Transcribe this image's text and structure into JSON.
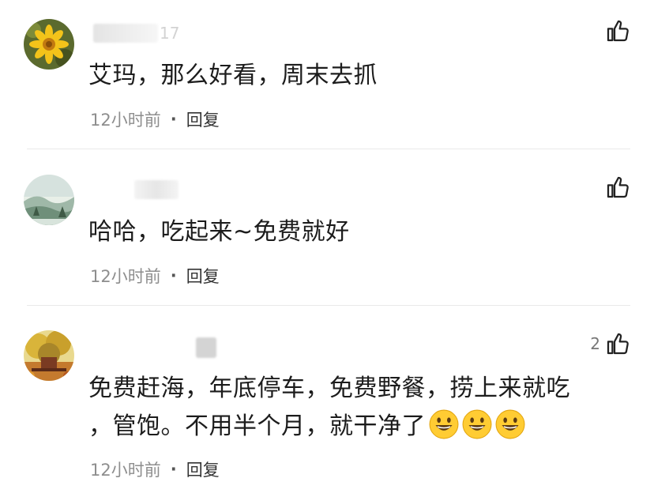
{
  "comments": [
    {
      "username_tail": "17",
      "text": "艾玛，那么好看，周末去抓",
      "time": "12小时前",
      "dot": "·",
      "reply": "回复",
      "likes": ""
    },
    {
      "username_tail": "",
      "text": "哈哈，吃起来~免费就好",
      "time": "12小时前",
      "dot": "·",
      "reply": "回复",
      "likes": ""
    },
    {
      "username_tail": "",
      "text_line1": "免费赶海，年底停车，免费野餐，捞上来就吃",
      "text_line2": "，管饱。不用半个月，就干净了",
      "time": "12小时前",
      "dot": "·",
      "reply": "回复",
      "likes": "2"
    }
  ],
  "icons": {
    "like": "thumbs-up-icon",
    "emoji": "grinning-face-icon"
  },
  "colors": {
    "text": "#1c1c1c",
    "meta": "#8e8e8e",
    "divider": "#e9e9e9"
  }
}
